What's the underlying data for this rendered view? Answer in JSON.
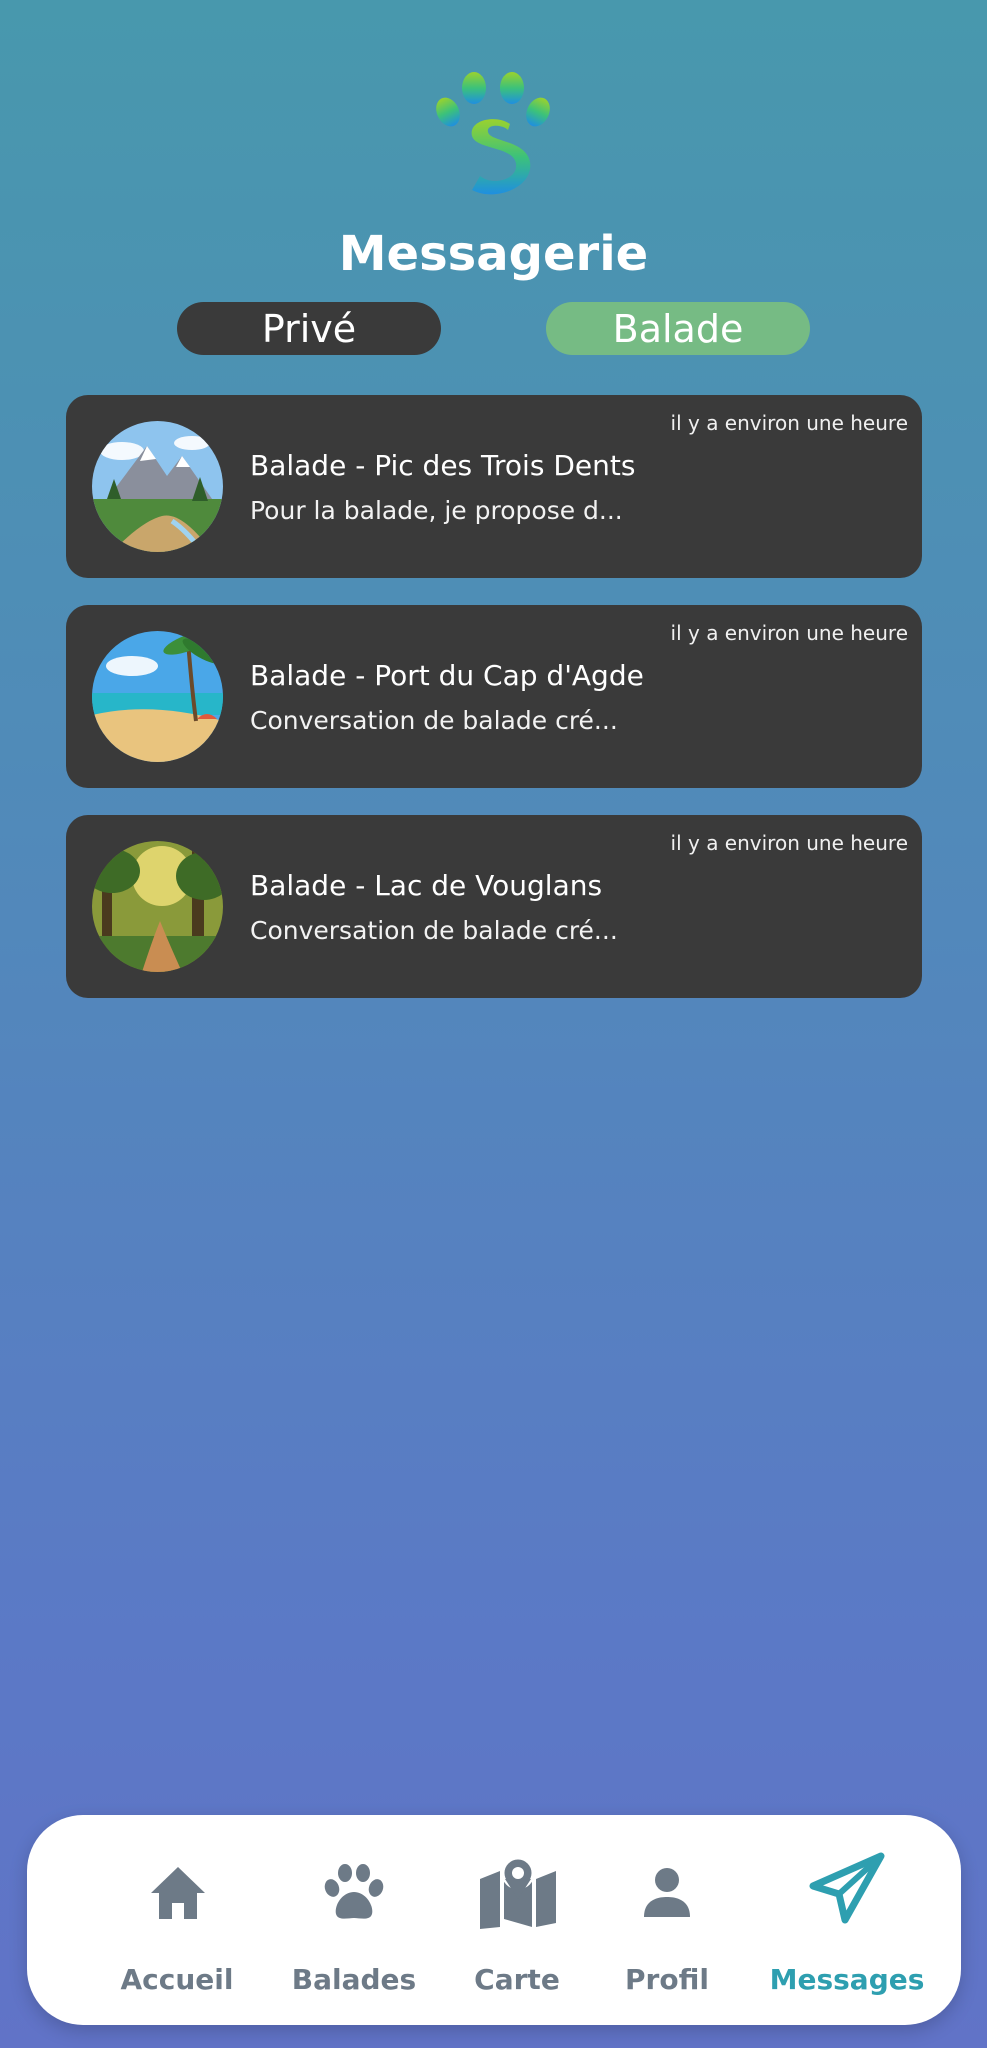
{
  "header": {
    "title": "Messagerie"
  },
  "tabs": [
    {
      "label": "Privé",
      "active": false
    },
    {
      "label": "Balade",
      "active": true
    }
  ],
  "conversations": [
    {
      "name": "Balade - Pic des Trois Dents",
      "preview": "Pour la balade, je propose d...",
      "time": "il y a environ une heure",
      "thumbnail": "mountain-landscape"
    },
    {
      "name": "Balade - Port du Cap d'Agde",
      "preview": "Conversation de balade cré...",
      "time": "il y a environ une heure",
      "thumbnail": "beach-landscape"
    },
    {
      "name": "Balade - Lac de Vouglans",
      "preview": "Conversation de balade cré...",
      "time": "il y a environ une heure",
      "thumbnail": "forest-path-landscape"
    }
  ],
  "bottom_nav": {
    "items": [
      {
        "label": "Accueil",
        "icon": "home-icon"
      },
      {
        "label": "Balades",
        "icon": "paw-icon"
      },
      {
        "label": "Carte",
        "icon": "map-icon"
      },
      {
        "label": "Profil",
        "icon": "person-icon"
      },
      {
        "label": "Messages",
        "icon": "send-icon",
        "active": true
      }
    ]
  },
  "colors": {
    "accent": "#2e9fb0",
    "tab_active": "#76bb84",
    "card_bg": "#3a3a3a",
    "nav_inactive": "#6d7a87"
  }
}
